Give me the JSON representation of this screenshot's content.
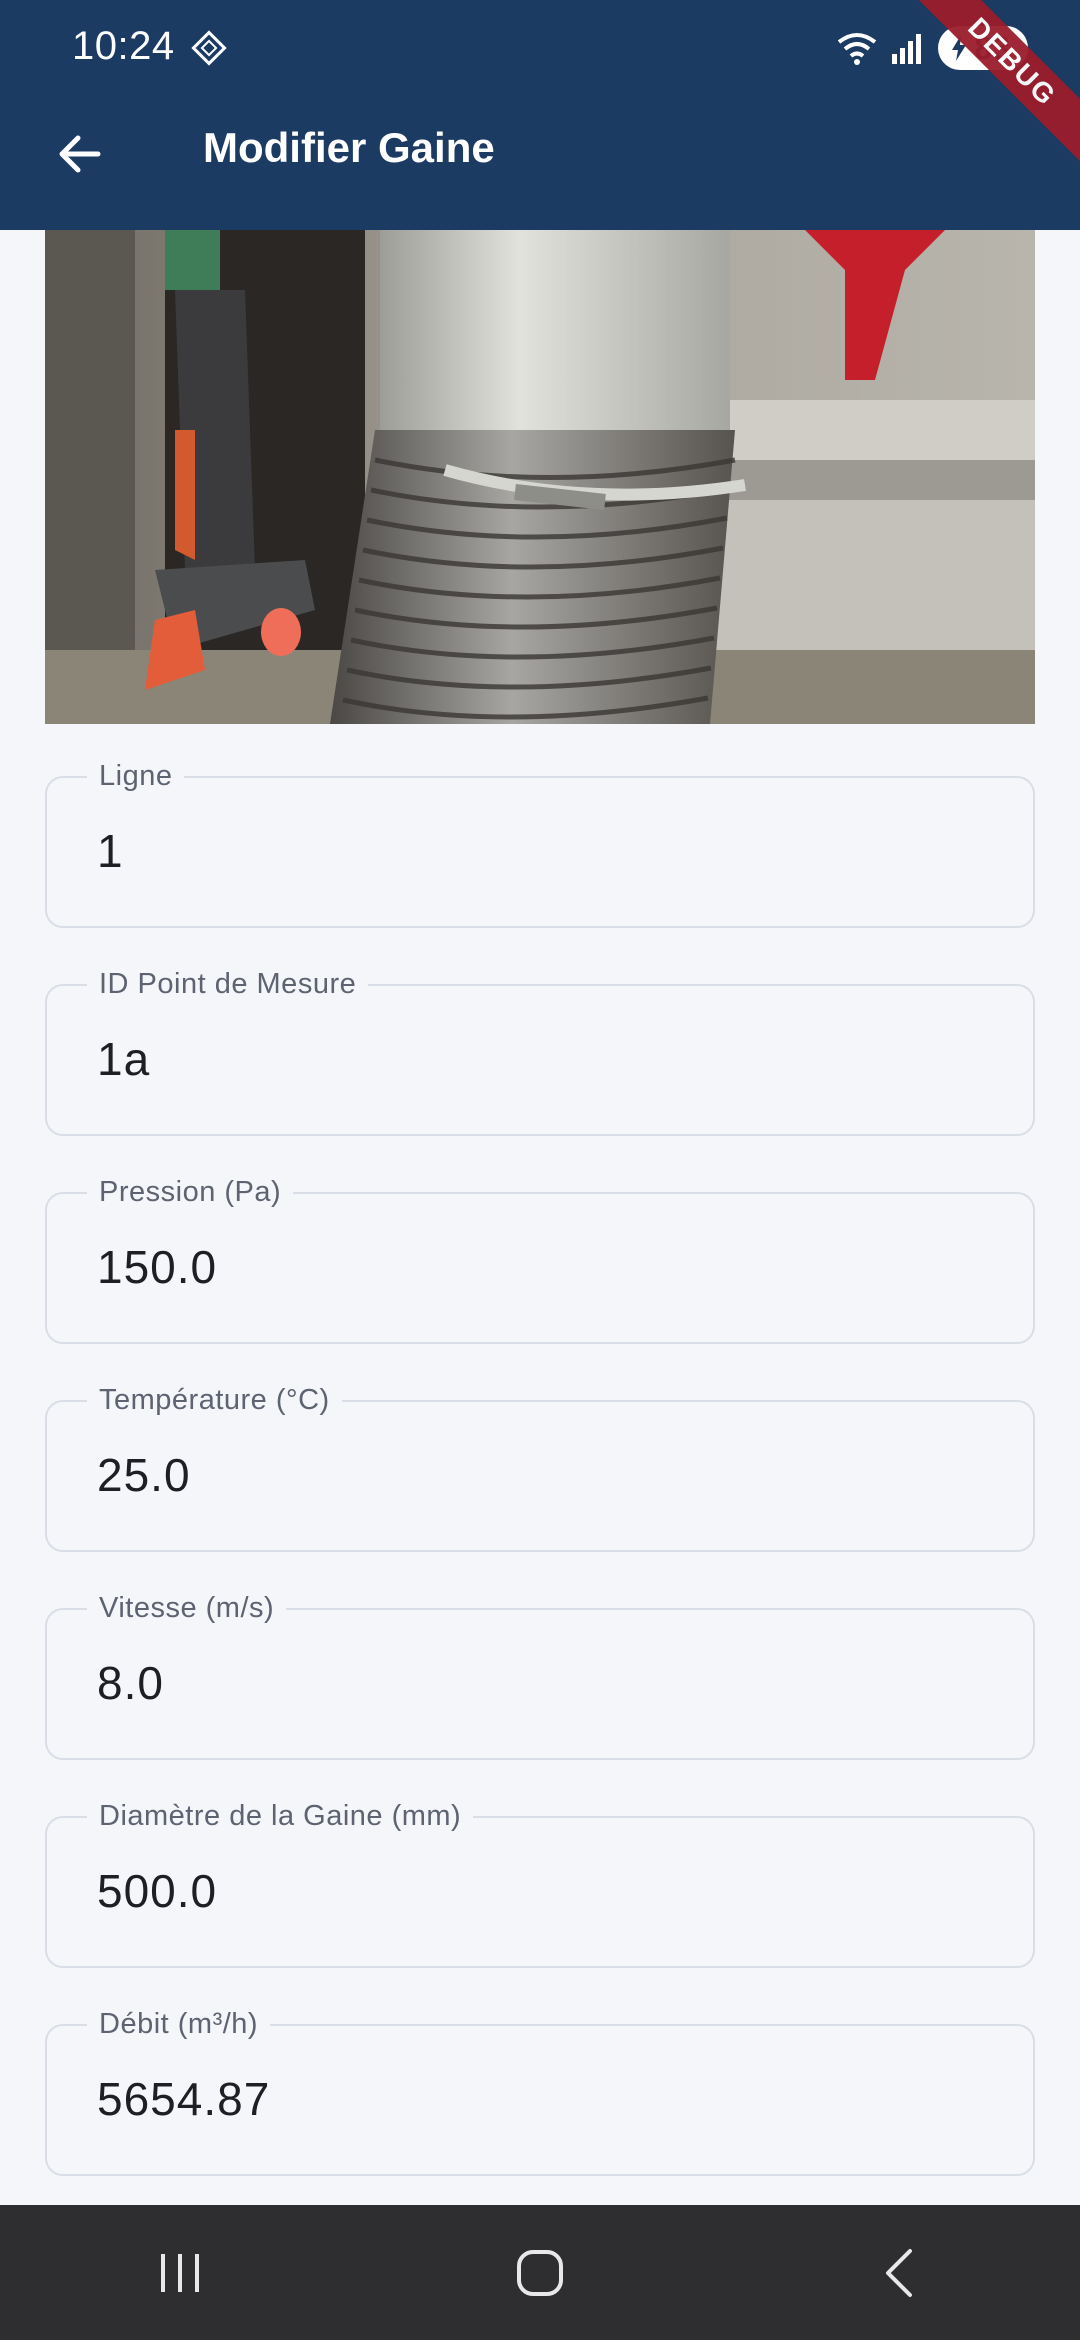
{
  "status_bar": {
    "time": "10:24",
    "battery_level": "83",
    "debug_banner": "DEBUG",
    "icons": [
      "diamond-icon",
      "wifi-icon",
      "signal-icon",
      "battery-charging-icon"
    ]
  },
  "app_bar": {
    "title": "Modifier Gaine",
    "back_icon": "arrow-left-icon",
    "background_color": "#1b3b63"
  },
  "photo": {
    "subject": "duct-hose-photo"
  },
  "fields": [
    {
      "label": "Ligne",
      "value": "1"
    },
    {
      "label": "ID Point de Mesure",
      "value": "1a"
    },
    {
      "label": "Pression (Pa)",
      "value": "150.0"
    },
    {
      "label": "Température (°C)",
      "value": "25.0"
    },
    {
      "label": "Vitesse (m/s)",
      "value": "8.0"
    },
    {
      "label": "Diamètre de la Gaine (mm)",
      "value": "500.0"
    },
    {
      "label": "Débit (m³/h)",
      "value": "5654.87"
    }
  ],
  "nav_bar": {
    "icons": [
      "recent-apps-icon",
      "home-icon",
      "back-icon"
    ]
  }
}
